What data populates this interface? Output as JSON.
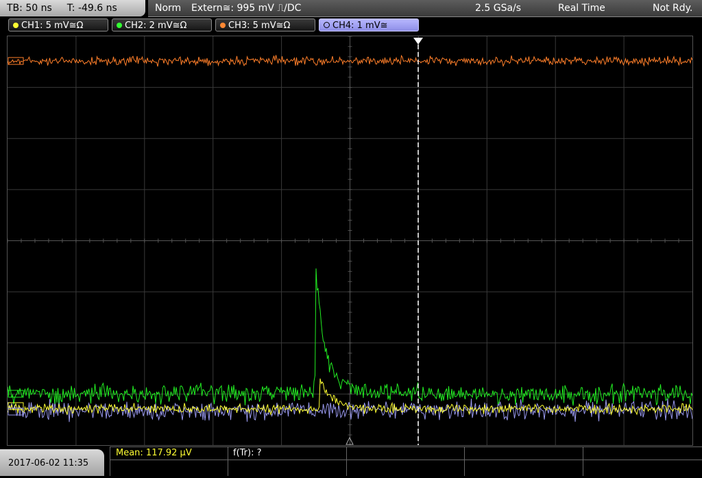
{
  "header": {
    "timebase": "TB: 50 ns",
    "trigger_time": "T: -49.6 ns",
    "trigger_mode": "Norm",
    "trigger_source": "Extern≅: 995 mV ⎍/DC",
    "sample_rate": "2.5 GSa/s",
    "acq_mode": "Real Time",
    "status": "Not Rdy."
  },
  "channels": [
    {
      "label": "CH1: 5 mV≅Ω",
      "color": "#ffff33",
      "active": false
    },
    {
      "label": "CH2: 2 mV≅Ω",
      "color": "#33ff33",
      "active": false
    },
    {
      "label": "CH3: 5 mV≅Ω",
      "color": "#ff8833",
      "active": false
    },
    {
      "label": "CH4: 1 mV≅",
      "color": "#9999ff",
      "active": true
    }
  ],
  "measurements": {
    "mean": "Mean: 117.92 µV",
    "rise_freq": "f(Tr): ?"
  },
  "datetime": "2017-06-02 11:35",
  "trace_colors": {
    "ch1": "#ffff33",
    "ch2": "#22ee22",
    "ch3": "#ff7f2a",
    "ch4": "#9999ee"
  }
}
